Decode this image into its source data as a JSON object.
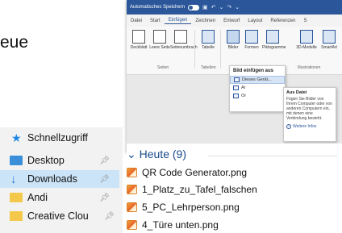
{
  "left_text": "eue",
  "word": {
    "titlebar": {
      "autosave_label": "Automatisches Speichern",
      "icons": [
        "toggle-switch",
        "save-icon",
        "undo-icon",
        "redo-icon",
        "dropdown-icon"
      ]
    },
    "tabs": [
      "Datei",
      "Start",
      "Einfügen",
      "Zeichnen",
      "Entwurf",
      "Layout",
      "Referenzen",
      "S"
    ],
    "active_tab": "Einfügen",
    "ribbon": {
      "items": [
        {
          "label": "Deckblatt"
        },
        {
          "label": "Leere Seite"
        },
        {
          "label": "Seitenumbruch"
        },
        {
          "label": "Tabelle"
        },
        {
          "label": "Bilder"
        },
        {
          "label": "Formen"
        },
        {
          "label": "Piktogramme"
        },
        {
          "label": "3D-Modelle"
        },
        {
          "label": "SmartArt"
        }
      ],
      "groups": [
        "Seiten",
        "Tabellen",
        "Illustrationen"
      ]
    },
    "insert_picture_menu": {
      "header": "Bild einfügen aus",
      "items": [
        {
          "label": "Dieses Gerät..."
        },
        {
          "label": "Ar"
        },
        {
          "label": "Or"
        }
      ]
    },
    "tooltip": {
      "title": "Aus Datei",
      "description": "Fügen Sie Bilder von Ihrem Computer oder von anderen Computern ein, mit denen eine Verbindung besteht.",
      "link": "Weitere Infos"
    }
  },
  "explorer": {
    "nav": [
      {
        "label": "Schnellzugriff",
        "icon": "star-icon"
      },
      {
        "label": "Desktop",
        "icon": "desktop-folder-icon",
        "pinned": true
      },
      {
        "label": "Downloads",
        "icon": "download-arrow-icon",
        "pinned": true,
        "selected": true
      },
      {
        "label": "Andi",
        "icon": "folder-icon",
        "pinned": true
      },
      {
        "label": "Creative Clou",
        "icon": "creative-cloud-folder-icon",
        "pinned": true
      }
    ],
    "group_header": "Heute (9)",
    "files": [
      {
        "name": "QR Code Generator.png"
      },
      {
        "name": "1_Platz_zu_Tafel_falschen"
      },
      {
        "name": "5_PC_Lehrperson.png"
      },
      {
        "name": "4_Türe unten.png"
      }
    ]
  }
}
